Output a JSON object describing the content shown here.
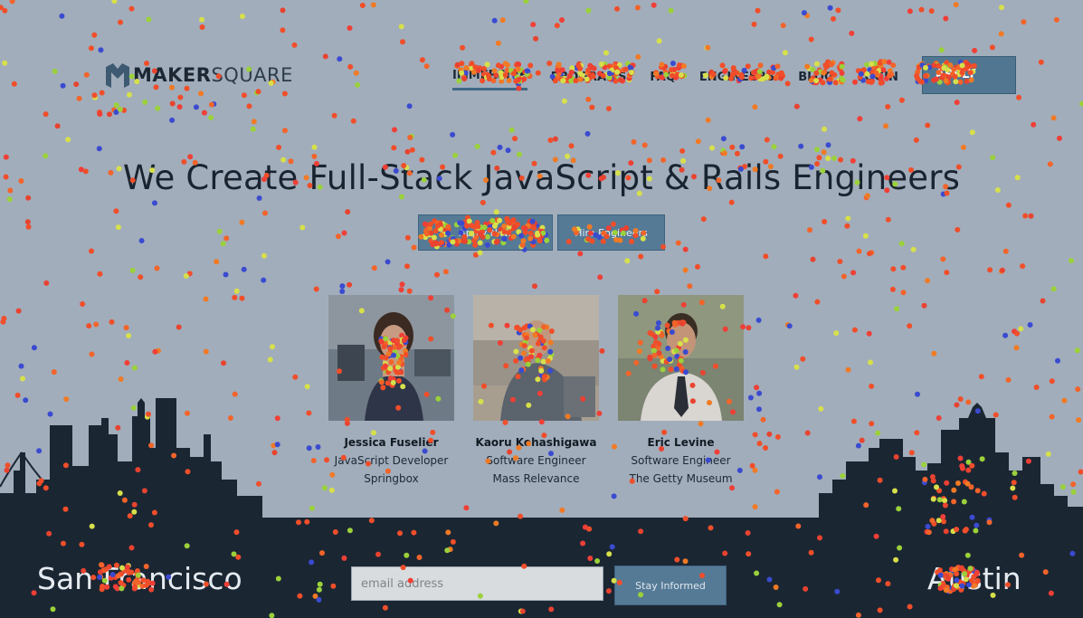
{
  "brand": {
    "logo_bold": "MAKER",
    "logo_light": "SQUARE",
    "icon": "makersquare-logo-icon"
  },
  "nav": {
    "items": [
      {
        "label": "IMMERSIVE",
        "active": true
      },
      {
        "label": "PROGRAMS",
        "active": false
      },
      {
        "label": "FAQ",
        "active": false
      },
      {
        "label": "ENGINEERS",
        "active": false
      },
      {
        "label": "BLOG",
        "active": false
      },
      {
        "label": "LOGIN",
        "active": false
      }
    ],
    "cta_label": "APPLY"
  },
  "hero": {
    "headline": "We Create Full-Stack JavaScript & Rails Engineers",
    "apply_button": "Apply Now",
    "hire_button": "Hire Engineers"
  },
  "graduates": [
    {
      "name": "Jessica Fuselier",
      "role": "JavaScript Developer",
      "company": "Springbox"
    },
    {
      "name": "Kaoru Kohashigawa",
      "role": "Software Engineer",
      "company": "Mass Relevance"
    },
    {
      "name": "Eric Levine",
      "role": "Software Engineer",
      "company": "The Getty Museum"
    }
  ],
  "footer": {
    "city_left": "San Francisco",
    "city_right": "Austin",
    "email_placeholder": "email address",
    "stay_button": "Stay Informed"
  },
  "colors": {
    "background": "#a1adbb",
    "skyline": "#1b2633",
    "button": "#557a96",
    "heatmap_dot": "#f04e2a"
  }
}
